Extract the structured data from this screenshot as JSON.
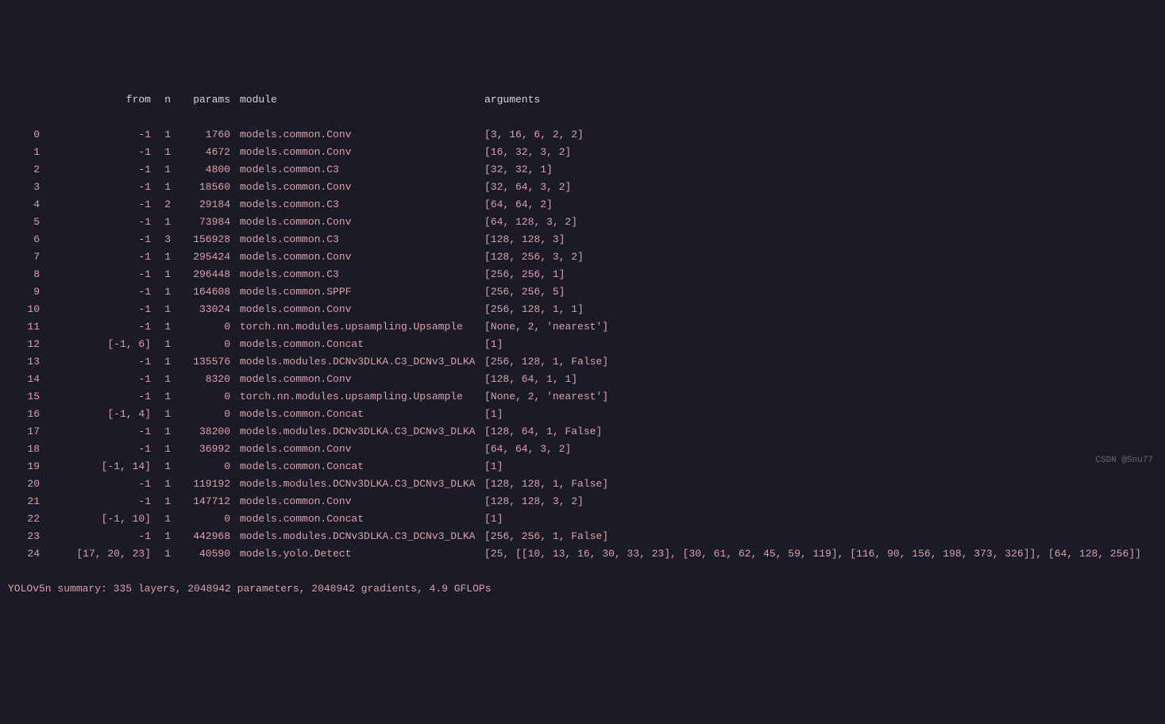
{
  "headers": {
    "idx": "",
    "from": "from",
    "n": "n",
    "params": "params",
    "module": "module",
    "arguments": "arguments"
  },
  "rows": [
    {
      "idx": "0",
      "from": "-1",
      "n": "1",
      "params": "1760",
      "module": "models.common.Conv",
      "args": "[3, 16, 6, 2, 2]"
    },
    {
      "idx": "1",
      "from": "-1",
      "n": "1",
      "params": "4672",
      "module": "models.common.Conv",
      "args": "[16, 32, 3, 2]"
    },
    {
      "idx": "2",
      "from": "-1",
      "n": "1",
      "params": "4800",
      "module": "models.common.C3",
      "args": "[32, 32, 1]"
    },
    {
      "idx": "3",
      "from": "-1",
      "n": "1",
      "params": "18560",
      "module": "models.common.Conv",
      "args": "[32, 64, 3, 2]"
    },
    {
      "idx": "4",
      "from": "-1",
      "n": "2",
      "params": "29184",
      "module": "models.common.C3",
      "args": "[64, 64, 2]"
    },
    {
      "idx": "5",
      "from": "-1",
      "n": "1",
      "params": "73984",
      "module": "models.common.Conv",
      "args": "[64, 128, 3, 2]"
    },
    {
      "idx": "6",
      "from": "-1",
      "n": "3",
      "params": "156928",
      "module": "models.common.C3",
      "args": "[128, 128, 3]"
    },
    {
      "idx": "7",
      "from": "-1",
      "n": "1",
      "params": "295424",
      "module": "models.common.Conv",
      "args": "[128, 256, 3, 2]"
    },
    {
      "idx": "8",
      "from": "-1",
      "n": "1",
      "params": "296448",
      "module": "models.common.C3",
      "args": "[256, 256, 1]"
    },
    {
      "idx": "9",
      "from": "-1",
      "n": "1",
      "params": "164608",
      "module": "models.common.SPPF",
      "args": "[256, 256, 5]"
    },
    {
      "idx": "10",
      "from": "-1",
      "n": "1",
      "params": "33024",
      "module": "models.common.Conv",
      "args": "[256, 128, 1, 1]"
    },
    {
      "idx": "11",
      "from": "-1",
      "n": "1",
      "params": "0",
      "module": "torch.nn.modules.upsampling.Upsample",
      "args": "[None, 2, 'nearest']"
    },
    {
      "idx": "12",
      "from": "[-1, 6]",
      "n": "1",
      "params": "0",
      "module": "models.common.Concat",
      "args": "[1]"
    },
    {
      "idx": "13",
      "from": "-1",
      "n": "1",
      "params": "135576",
      "module": "models.modules.DCNv3DLKA.C3_DCNv3_DLKA",
      "args": "[256, 128, 1, False]"
    },
    {
      "idx": "14",
      "from": "-1",
      "n": "1",
      "params": "8320",
      "module": "models.common.Conv",
      "args": "[128, 64, 1, 1]"
    },
    {
      "idx": "15",
      "from": "-1",
      "n": "1",
      "params": "0",
      "module": "torch.nn.modules.upsampling.Upsample",
      "args": "[None, 2, 'nearest']"
    },
    {
      "idx": "16",
      "from": "[-1, 4]",
      "n": "1",
      "params": "0",
      "module": "models.common.Concat",
      "args": "[1]"
    },
    {
      "idx": "17",
      "from": "-1",
      "n": "1",
      "params": "38200",
      "module": "models.modules.DCNv3DLKA.C3_DCNv3_DLKA",
      "args": "[128, 64, 1, False]"
    },
    {
      "idx": "18",
      "from": "-1",
      "n": "1",
      "params": "36992",
      "module": "models.common.Conv",
      "args": "[64, 64, 3, 2]"
    },
    {
      "idx": "19",
      "from": "[-1, 14]",
      "n": "1",
      "params": "0",
      "module": "models.common.Concat",
      "args": "[1]"
    },
    {
      "idx": "20",
      "from": "-1",
      "n": "1",
      "params": "119192",
      "module": "models.modules.DCNv3DLKA.C3_DCNv3_DLKA",
      "args": "[128, 128, 1, False]"
    },
    {
      "idx": "21",
      "from": "-1",
      "n": "1",
      "params": "147712",
      "module": "models.common.Conv",
      "args": "[128, 128, 3, 2]"
    },
    {
      "idx": "22",
      "from": "[-1, 10]",
      "n": "1",
      "params": "0",
      "module": "models.common.Concat",
      "args": "[1]"
    },
    {
      "idx": "23",
      "from": "-1",
      "n": "1",
      "params": "442968",
      "module": "models.modules.DCNv3DLKA.C3_DCNv3_DLKA",
      "args": "[256, 256, 1, False]"
    },
    {
      "idx": "24",
      "from": "[17, 20, 23]",
      "n": "1",
      "params": "40590",
      "module": "models.yolo.Detect",
      "args": "[25, [[10, 13, 16, 30, 33, 23], [30, 61, 62, 45, 59, 119], [116, 90, 156, 198, 373, 326]], [64, 128, 256]]"
    }
  ],
  "summary": "YOLOv5n summary: 335 layers, 2048942 parameters, 2048942 gradients, 4.9 GFLOPs",
  "watermark": "CSDN @Snu77"
}
